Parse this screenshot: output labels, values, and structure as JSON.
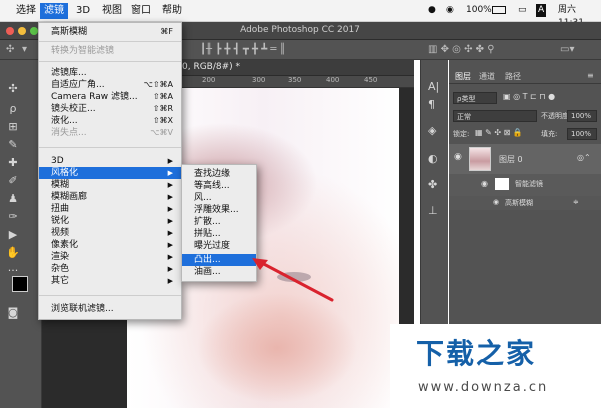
{
  "menubar": {
    "items": [
      "选择",
      "滤镜",
      "3D",
      "视图",
      "窗口",
      "帮助"
    ],
    "status": {
      "battery": "100%",
      "clock": "周六11:31"
    }
  },
  "app": {
    "title": "Adobe Photoshop CC 2017",
    "tab_label": "0, RGB/8#) *",
    "ruler_numbers": [
      "200",
      "300",
      "350",
      "400",
      "450"
    ]
  },
  "filter_menu": {
    "items": [
      {
        "label": "高斯模糊",
        "shortcut": "⌘F"
      },
      {
        "label": "转换为智能滤镜",
        "disabled": true
      },
      {
        "label": "滤镜库..."
      },
      {
        "label": "自适应广角...",
        "shortcut": "⌥⇧⌘A"
      },
      {
        "label": "Camera Raw 滤镜...",
        "shortcut": "⇧⌘A"
      },
      {
        "label": "镜头校正...",
        "shortcut": "⇧⌘R"
      },
      {
        "label": "液化...",
        "shortcut": "⇧⌘X"
      },
      {
        "label": "消失点...",
        "shortcut": "⌥⌘V",
        "disabled": true
      },
      {
        "label": "3D"
      },
      {
        "label": "风格化",
        "selected": true
      },
      {
        "label": "模糊"
      },
      {
        "label": "模糊画廊"
      },
      {
        "label": "扭曲"
      },
      {
        "label": "锐化"
      },
      {
        "label": "视频"
      },
      {
        "label": "像素化"
      },
      {
        "label": "渲染"
      },
      {
        "label": "杂色"
      },
      {
        "label": "其它"
      },
      {
        "label": "浏览联机滤镜..."
      }
    ]
  },
  "stylize_submenu": {
    "items": [
      {
        "label": "查找边缘"
      },
      {
        "label": "等高线..."
      },
      {
        "label": "风..."
      },
      {
        "label": "浮雕效果..."
      },
      {
        "label": "扩散..."
      },
      {
        "label": "拼贴..."
      },
      {
        "label": "曝光过度"
      },
      {
        "label": "凸出...",
        "selected": true
      },
      {
        "label": "油画..."
      }
    ]
  },
  "layers_panel": {
    "tabs": [
      "图层",
      "通道",
      "路径"
    ],
    "kind_filter": "ρ类型",
    "blend_mode": "正常",
    "opacity_label": "不透明度:",
    "opacity_value": "100%",
    "lock_label": "锁定:",
    "fill_label": "填充:",
    "fill_value": "100%",
    "layer_name": "图层 0",
    "smart_filter": "智能滤镜",
    "sub_filter": "高斯模糊"
  },
  "watermark": {
    "title": "下载之家",
    "url": "www.downza.cn"
  },
  "colors": {
    "accent": "#1e6fdb",
    "panel": "#535353",
    "arrow": "#d9232e"
  }
}
